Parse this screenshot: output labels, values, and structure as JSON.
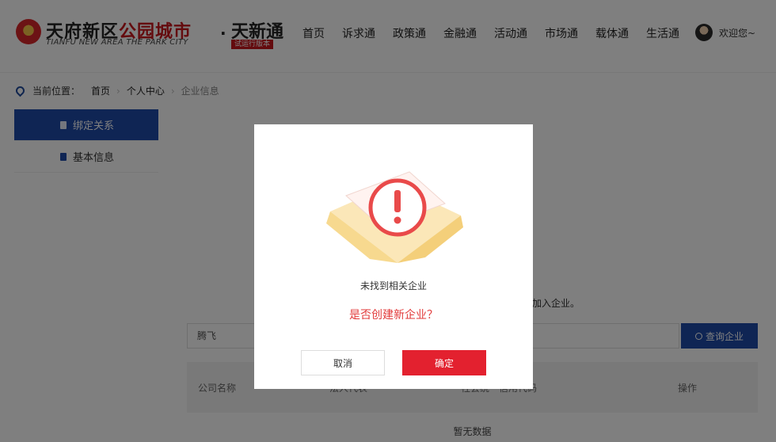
{
  "header": {
    "logo_title_a": "天府新区",
    "logo_title_b": "公园城市",
    "logo_sub": "TIANFU NEW AREA THE PARK CITY",
    "brand_dot": "·",
    "brand": "天新通",
    "brand_badge": "试运行版本",
    "nav": [
      "首页",
      "诉求通",
      "政策通",
      "金融通",
      "活动通",
      "市场通",
      "载体通",
      "生活通"
    ],
    "welcome": "欢迎您~"
  },
  "breadcrumb": {
    "label": "当前位置：",
    "items": [
      "首页",
      "个人中心",
      "企业信息"
    ]
  },
  "sidebar": {
    "items": [
      {
        "label": "绑定关系",
        "active": true
      },
      {
        "label": "基本信息",
        "active": false
      }
    ]
  },
  "content": {
    "hint": "加入企业。",
    "search_value": "腾飞",
    "search_button": "查询企业",
    "table_headers": [
      "公司名称",
      "法人代表",
      "社会统一信用代码",
      "操作"
    ],
    "empty": "暂无数据"
  },
  "modal": {
    "message": "未找到相关企业",
    "question": "是否创建新企业？",
    "cancel": "取消",
    "confirm": "确定"
  },
  "colors": {
    "primary": "#1e4aa8",
    "danger": "#e3212f",
    "brand_red": "#c8161d"
  }
}
